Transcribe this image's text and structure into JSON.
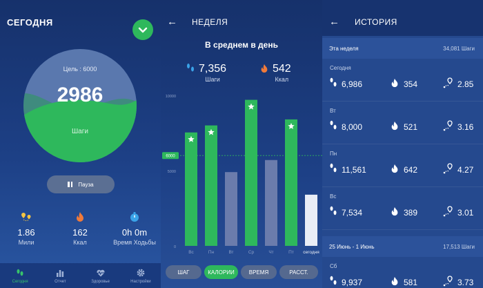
{
  "today": {
    "title": "СЕГОДНЯ",
    "goal_label": "Цель : 6000",
    "steps_value": "2986",
    "steps_label": "Шаги",
    "progress_fraction": 0.5,
    "pause_label": "Пауза",
    "stats": [
      {
        "icon": "map-pin-icon",
        "value": "1.86",
        "label": "Мили"
      },
      {
        "icon": "flame-icon",
        "value": "162",
        "label": "Ккал"
      },
      {
        "icon": "stopwatch-icon",
        "value": "0h 0m",
        "label": "Время Ходьбы"
      }
    ],
    "tabs": [
      {
        "icon": "footsteps-icon",
        "label": "Сегодня",
        "active": true
      },
      {
        "icon": "bar-chart-icon",
        "label": "Отчет",
        "active": false
      },
      {
        "icon": "heart-pulse-icon",
        "label": "Здоровье",
        "active": false
      },
      {
        "icon": "gear-icon",
        "label": "Настройки",
        "active": false
      }
    ]
  },
  "week": {
    "back": "←",
    "title": "НЕДЕЛЯ",
    "avg_title": "В среднем в день",
    "avg_steps": "7,356",
    "avg_steps_label": "Шаги",
    "avg_kcal": "542",
    "avg_kcal_label": "Ккал",
    "chips": [
      {
        "label": "ШАГ",
        "active": false
      },
      {
        "label": "КАЛОРИИ",
        "active": true
      },
      {
        "label": "ВРЕМЯ",
        "active": false
      },
      {
        "label": "РАССТ.",
        "active": false
      }
    ]
  },
  "chart_data": {
    "type": "bar",
    "categories": [
      "Вс",
      "Пн",
      "Вт",
      "Ср",
      "Чт",
      "Пт",
      "сегодня"
    ],
    "values": [
      7534,
      8000,
      4900,
      9700,
      5700,
      8400,
      3400
    ],
    "goal_reached": [
      true,
      true,
      false,
      true,
      false,
      true,
      false
    ],
    "today_index": 6,
    "ylim": [
      0,
      10000
    ],
    "yticks": [
      {
        "value": 0,
        "label": "0"
      },
      {
        "value": 5000,
        "label": "5000"
      },
      {
        "value": 10000,
        "label": "10000"
      }
    ],
    "goal_line": {
      "value": 6000,
      "label": "6000"
    },
    "colors": {
      "goal": "#2eb85c",
      "below": "#6b7cac",
      "today": "#e9edf6",
      "goal_line": "#2eb85c"
    }
  },
  "history": {
    "back": "←",
    "title": "ИСТОРИЯ",
    "sections": [
      {
        "header_left": "Эта неделя",
        "header_right": "34,081 Шаги",
        "days": [
          {
            "name": "Сегодня",
            "steps": "6,986",
            "kcal": "354",
            "dist": "2.85"
          },
          {
            "name": "Вт",
            "steps": "8,000",
            "kcal": "521",
            "dist": "3.16"
          },
          {
            "name": "Пн",
            "steps": "11,561",
            "kcal": "642",
            "dist": "4.27"
          },
          {
            "name": "Вс",
            "steps": "7,534",
            "kcal": "389",
            "dist": "3.01"
          }
        ]
      },
      {
        "header_left": "25 Июнь - 1 Июнь",
        "header_right": "17,513 Шаги",
        "days": [
          {
            "name": "Сб",
            "steps": "9,937",
            "kcal": "581",
            "dist": "3.73"
          }
        ]
      }
    ]
  }
}
